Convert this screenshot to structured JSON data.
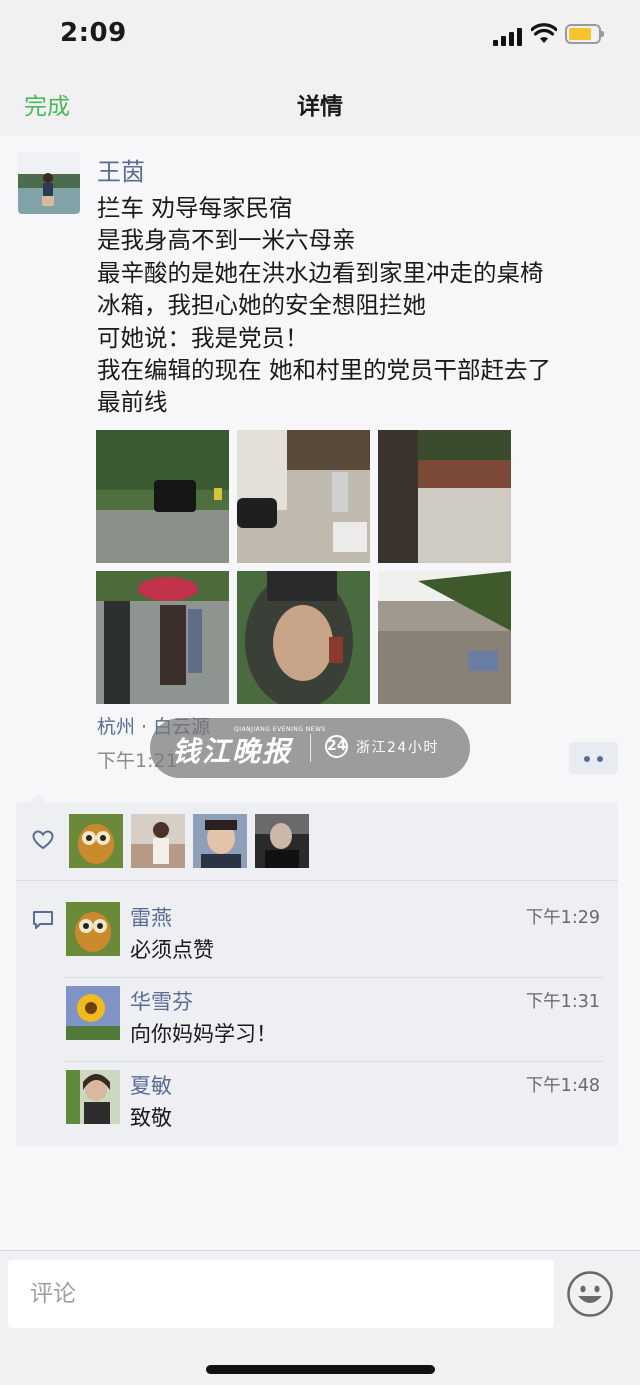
{
  "status_bar": {
    "time": "2:09"
  },
  "nav": {
    "done_label": "完成",
    "title": "详情"
  },
  "post": {
    "author": "王茵",
    "lines": [
      "拦车 劝导每家民宿",
      "是我身高不到一米六母亲",
      "最辛酸的是她在洪水边看到家里冲走的桌椅",
      "冰箱，我担心她的安全想阻拦她",
      "可她说：我是党员！",
      "我在编辑的现在 她和村里的党员干部赶去了",
      "最前线"
    ],
    "location": "杭州 · 白云源",
    "time": "下午1:21"
  },
  "watermark": {
    "logo": "钱江晚报",
    "logo_small": "QIANJIANG EVENING NEWS",
    "circle": "24",
    "text": "浙江24小时"
  },
  "comments": [
    {
      "name": "雷燕",
      "time": "下午1:29",
      "text": "必须点赞"
    },
    {
      "name": "华雪芬",
      "time": "下午1:31",
      "text": "向你妈妈学习！"
    },
    {
      "name": "夏敏",
      "time": "下午1:48",
      "text": "致敬"
    }
  ],
  "bottom": {
    "placeholder": "评论"
  },
  "colors": {
    "accent_green": "#4cb85a",
    "link_blue": "#5a6c92"
  }
}
